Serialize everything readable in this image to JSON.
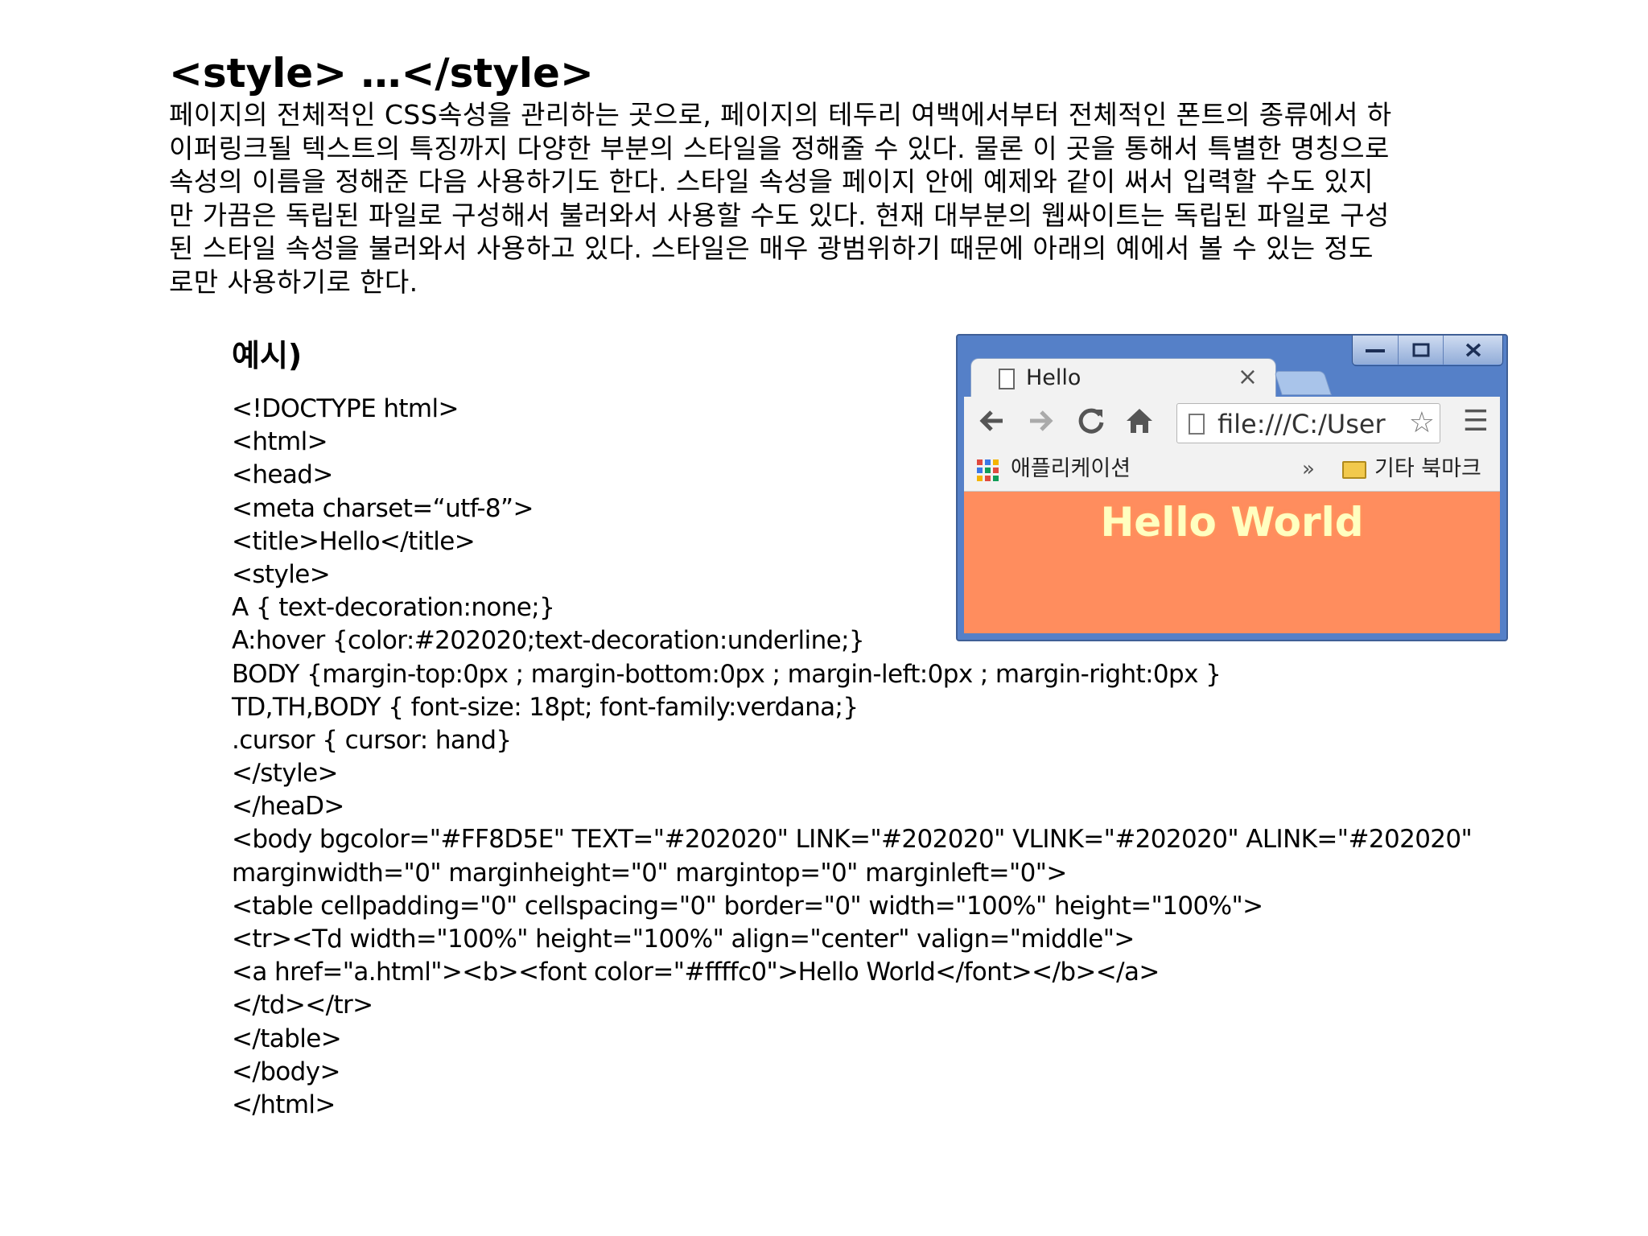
{
  "heading": "<style> …</style>",
  "intro_lines": [
    "페이지의 전체적인 CSS속성을 관리하는 곳으로, 페이지의 테두리 여백에서부터 전체적인 폰트의 종류에서 하",
    "이퍼링크될 텍스트의 특징까지 다양한 부분의 스타일을 정해줄 수 있다. 물론 이 곳을 통해서 특별한 명칭으로",
    "속성의 이름을 정해준 다음 사용하기도 한다. 스타일 속성을 페이지 안에 예제와 같이 써서 입력할 수도 있지",
    "만 가끔은 독립된 파일로 구성해서 불러와서 사용할 수도 있다. 현재 대부분의 웹싸이트는 독립된 파일로 구성",
    "된 스타일 속성을 불러와서 사용하고 있다. 스타일은 매우 광범위하기 때문에 아래의 예에서 볼 수 있는 정도",
    "로만 사용하기로 한다."
  ],
  "example_label": "예시)",
  "code_lines": [
    "<!DOCTYPE html>",
    "<html>",
    "<head>",
    "<meta charset=“utf-8”>",
    "<title>Hello</title>",
    "<style>",
    "A { text-decoration:none;}",
    "A:hover {color:#202020;text-decoration:underline;}",
    "BODY {margin-top:0px ; margin-bottom:0px ; margin-left:0px ; margin-right:0px }",
    "TD,TH,BODY { font-size: 18pt; font-family:verdana;}",
    ".cursor { cursor: hand}",
    "</style>",
    "</heaD>",
    "<body bgcolor=\"#FF8D5E\" TEXT=\"#202020\" LINK=\"#202020\" VLINK=\"#202020\" ALINK=\"#202020\"",
    "marginwidth=\"0\" marginheight=\"0\" margintop=\"0\" marginleft=\"0\">",
    "<table cellpadding=\"0\" cellspacing=\"0\" border=\"0\" width=\"100%\" height=\"100%\">",
    "<tr><Td width=\"100%\" height=\"100%\" align=\"center\" valign=\"middle\">",
    "<a href=\"a.html\"><b><font color=\"#ffffc0\">Hello World</font></b></a>",
    "</td></tr>",
    "</table>",
    "</body>",
    "</html>"
  ],
  "browser": {
    "tab_title": "Hello",
    "tab_close": "×",
    "url": "file:///C:/User",
    "bookmark_apps": "애플리케이션",
    "bookmark_chevron": "»",
    "bookmark_other": "기타 북마크",
    "page_text": "Hello World",
    "icons": {
      "minimize": "minimize-icon",
      "maximize": "maximize-icon",
      "close": "close-icon",
      "back": "back-arrow-icon",
      "forward": "forward-arrow-icon",
      "reload": "reload-icon",
      "home": "home-icon",
      "star": "star-icon",
      "menu": "menu-icon",
      "apps": "apps-grid-icon",
      "folder": "folder-icon"
    },
    "colors": {
      "frame": "#5580c8",
      "page_background": "#ff8d5e",
      "page_text": "#ffffc0"
    }
  }
}
